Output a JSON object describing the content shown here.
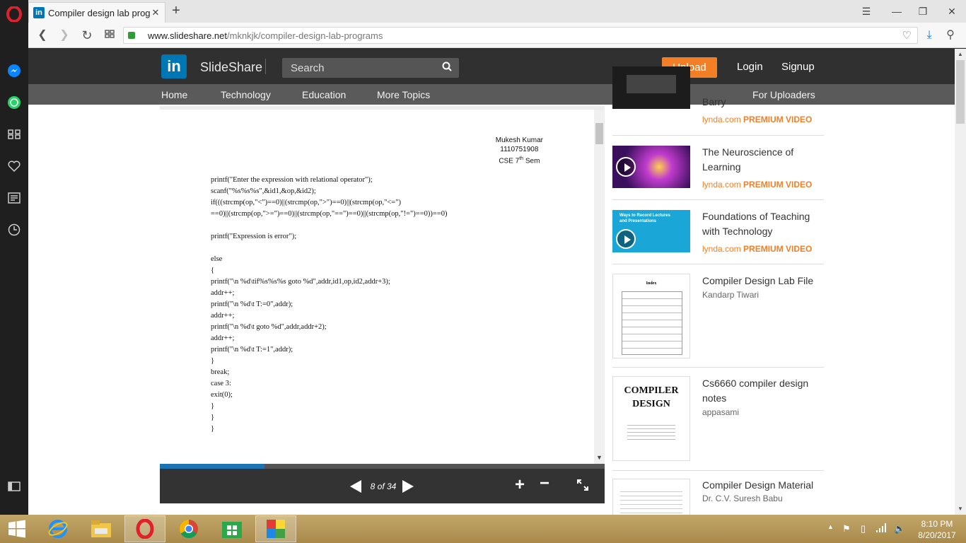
{
  "browser": {
    "tab_title": "Compiler design lab progr",
    "tab_favicon_text": "in",
    "url_host": "www.slideshare.net",
    "url_path": "/mknkjk/compiler-design-lab-programs"
  },
  "slideshare": {
    "logo_text": "SlideShare",
    "search_placeholder": "Search",
    "upload_label": "Upload",
    "login_label": "Login",
    "signup_label": "Signup",
    "nav": [
      "Home",
      "Technology",
      "Education",
      "More Topics"
    ],
    "for_uploaders": "For Uploaders"
  },
  "document": {
    "author": "Mukesh Kumar",
    "roll": "1110751908",
    "sem_prefix": "CSE 7",
    "sem_sup": "th",
    "sem_suffix": " Sem",
    "code": "printf(\"Enter the expression with relational operator\");\nscanf(\"%s%s%s\",&id1,&op,&id2);\nif(((strcmp(op,\"<\")==0)||(strcmp(op,\">\")==0)||(strcmp(op,\"<=\")\n==0)||(strcmp(op,\">=\")==0)||(strcmp(op,\"==\")==0)||(strcmp(op,\"!=\")==0))==0)\n\nprintf(\"Expression is error\");\n\nelse\n{\nprintf(\"\\n %d\\tif%s%s%s goto %d\",addr,id1,op,id2,addr+3);\naddr++;\nprintf(\"\\n %d\\t T:=0\",addr);\naddr++;\nprintf(\"\\n %d\\t goto %d\",addr,addr+2);\naddr++;\nprintf(\"\\n %d\\t T:=1\",addr);\n}\nbreak;\ncase 3:\nexit(0);\n}\n}\n}",
    "pager": "8 of 34",
    "progress": 0.235
  },
  "related": [
    {
      "title": "Barry",
      "sub_brand": "lynda.com",
      "sub_tag": "PREMIUM VIDEO"
    },
    {
      "title": "The Neuroscience of Learning",
      "sub_brand": "lynda.com",
      "sub_tag": "PREMIUM VIDEO"
    },
    {
      "title": "Foundations of Teaching with Technology",
      "sub_brand": "lynda.com",
      "sub_tag": "PREMIUM VIDEO",
      "thumb_text": "Ways to Record Lectures and Presentations"
    },
    {
      "title": "Compiler Design Lab File",
      "author": "Kandarp Tiwari",
      "thumb_text": "Index"
    },
    {
      "title": "Cs6660 compiler design notes",
      "author": "appasami",
      "thumb_text": "COMPILER DESIGN"
    },
    {
      "title": "Compiler Design Material",
      "author": "Dr. C.V. Suresh Babu"
    }
  ],
  "taskbar": {
    "time": "8:10 PM",
    "date": "8/20/2017"
  },
  "colors": {
    "slideshare_orange": "#f27f25",
    "linkedin_blue": "#0077b5",
    "header_dark": "#303030"
  }
}
